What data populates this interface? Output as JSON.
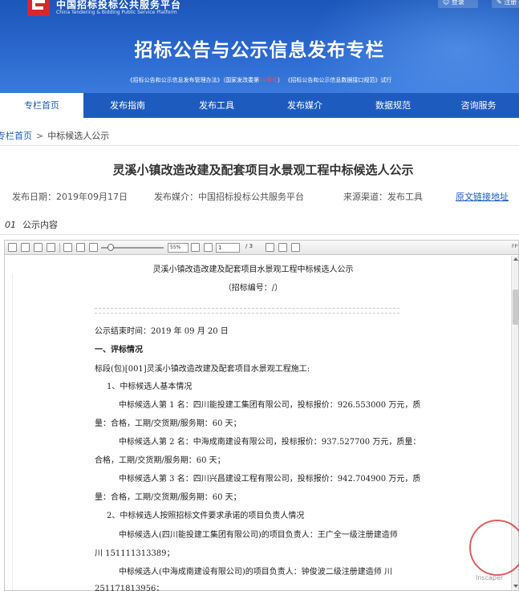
{
  "header": {
    "site_name_cn": "中国招标投标公共服务平台",
    "site_name_en": "China Tendering & Bidding Public Service Platform",
    "login": "登录",
    "register": "注册",
    "banner_title": "招标公告与公示信息发布专栏",
    "banner_sub_1": "《招标公告和公示信息发布管理办法》（国家发改委第",
    "banner_sub_red": "10号令",
    "banner_sub_2": "）        《招标公告和公示信息数据接口规范》试行"
  },
  "nav": {
    "items": [
      {
        "label": "专栏首页",
        "active": true
      },
      {
        "label": "发布指南",
        "active": false
      },
      {
        "label": "发布工具",
        "active": false
      },
      {
        "label": "发布媒介",
        "active": false
      },
      {
        "label": "数据规范",
        "active": false
      },
      {
        "label": "咨询服务",
        "active": false
      }
    ]
  },
  "breadcrumb": {
    "home": "专栏首页",
    "sep": ">",
    "current": "中标候选人公示"
  },
  "article": {
    "title": "灵溪小镇改造改建及配套项目水景观工程中标候选人公示",
    "publish_date": "发布日期：2019年09月17日",
    "publish_media": "发布媒介：中国招标投标公共服务平台",
    "source": "来源渠道：发布工具",
    "original_link": "原文链接地址",
    "section_num": "01",
    "section_label": "公示内容"
  },
  "viewer": {
    "zoom": "55%",
    "page_current": "1",
    "page_total": "/  3",
    "fp": "FP"
  },
  "pdf": {
    "title": "灵溪小镇改造改建及配套项目水景观工程中标候选人公示",
    "subtitle": "（招标编号：/）",
    "end_time": "公示结束时间：2019 年 09 月 20 日",
    "h1": "一、评标情况",
    "lot": "标段(包)[001]灵溪小镇改造改建及配套项目水景观工程施工:",
    "s1": "1、中标候选人基本情况",
    "c1a": "中标候选人第 1 名：四川能投建工集团有限公司，投标报价：926.553000 万元，质",
    "c1b": "量：合格，工期/交货期/服务期：60 天；",
    "c2a": "中标候选人第 2 名：中海成南建设有限公司，投标报价：937.527700 万元，质量：",
    "c2b": "合格，工期/交货期/服务期：60 天；",
    "c3a": "中标候选人第 3 名：四川兴昌建设工程有限公司，投标报价：942.704900 万元，质",
    "c3b": "量：合格，工期/交货期/服务期：60 天；",
    "s2": "2、中标候选人按照招标文件要求承诺的项目负责人情况",
    "p1a": "中标候选人(四川能投建工集团有限公司)的项目负责人：王广全一级注册建造师",
    "p1b": "川 151111313389；",
    "p2a": "中标候选人(中海成南建设有限公司)的项目负责人：钟俊波二级注册建造师 川",
    "p2b": "251171813956；",
    "watermark": "Inscaper"
  },
  "colors": {
    "brand_blue": "#1e5bbf",
    "stamp_red": "#d22828"
  }
}
